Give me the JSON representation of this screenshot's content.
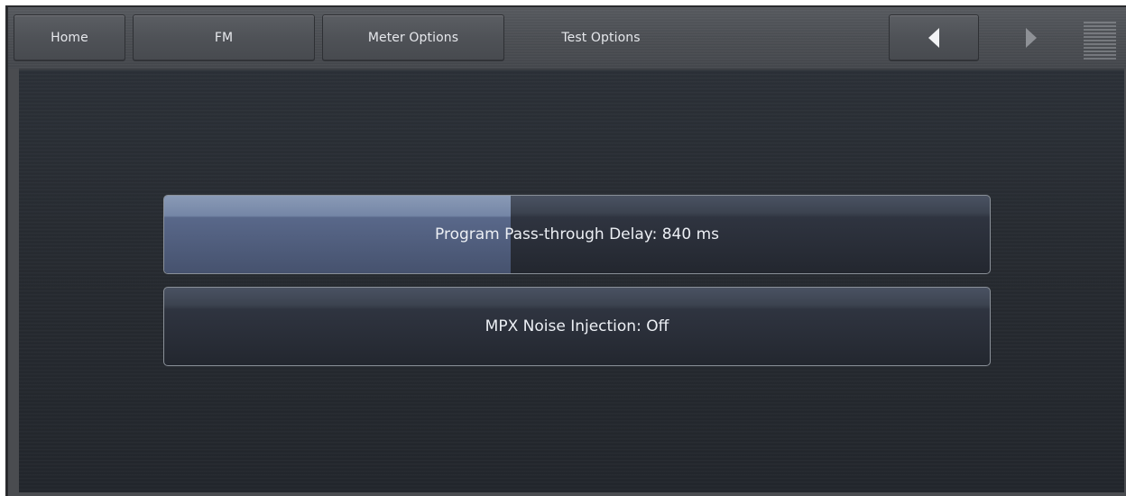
{
  "nav": {
    "tabs": [
      {
        "label": "Home"
      },
      {
        "label": "FM"
      },
      {
        "label": "Meter Options"
      },
      {
        "label": "Test Options"
      }
    ],
    "back_icon": "triangle-left-icon",
    "forward_icon": "triangle-right-icon",
    "menu_icon": "menu-lines-icon"
  },
  "settings": [
    {
      "label": "Program Pass-through Delay: 840 ms",
      "level_fraction": 0.42
    },
    {
      "label": "MPX Noise Injection: Off"
    }
  ],
  "colors": {
    "accent_fill": "#7486a6",
    "panel_bg": "#272b31",
    "text": "#eceff4"
  }
}
